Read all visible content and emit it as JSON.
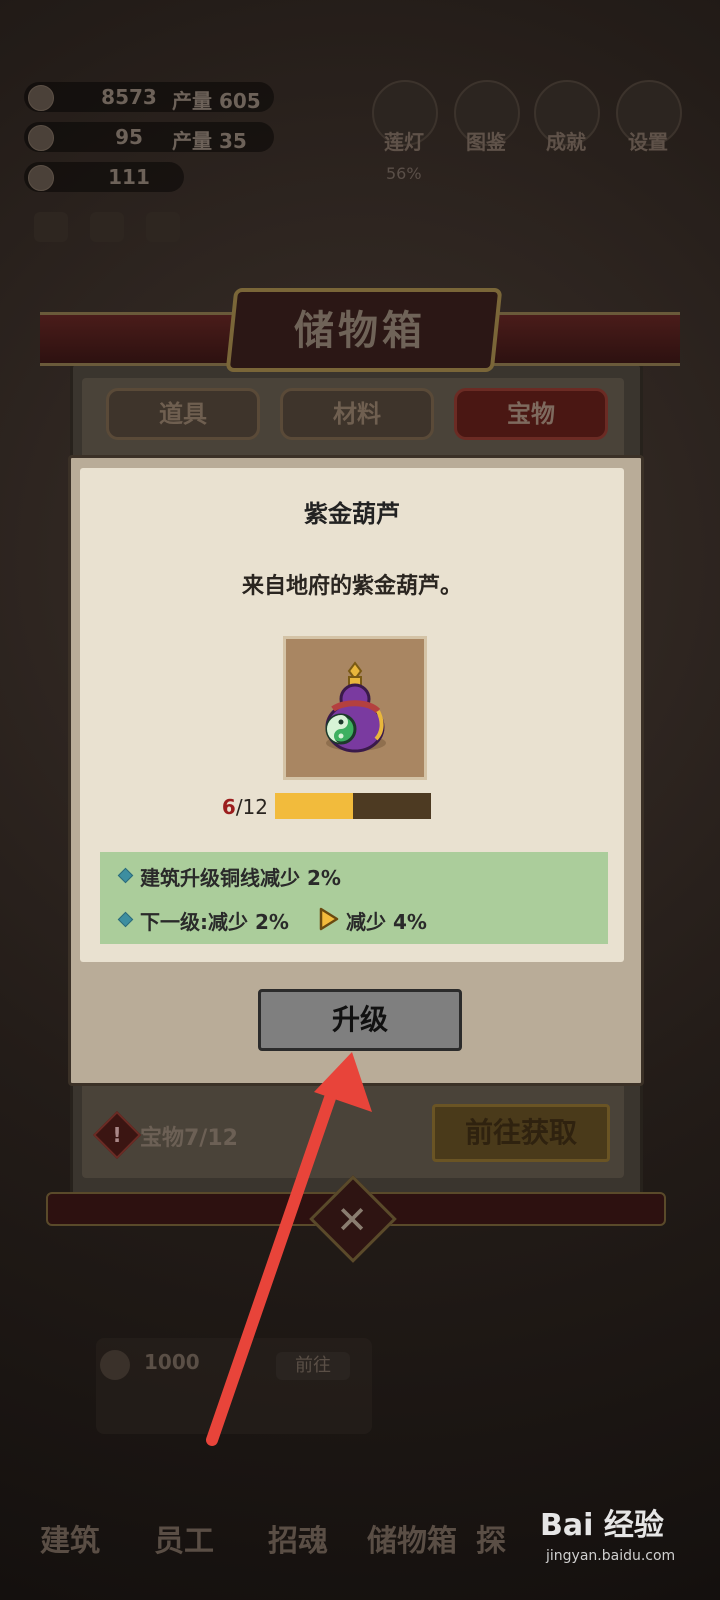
{
  "resources": [
    {
      "value": "8573",
      "production": "产量 605"
    },
    {
      "value": "95",
      "production": "产量 35"
    },
    {
      "value": "111",
      "production": ""
    }
  ],
  "top_buttons": [
    {
      "label": "莲灯",
      "icon": "lotus-icon",
      "sub": "56%"
    },
    {
      "label": "图鉴",
      "icon": "book-icon",
      "sub": ""
    },
    {
      "label": "成就",
      "icon": "banner-icon",
      "sub": ""
    },
    {
      "label": "设置",
      "icon": "gear-icon",
      "sub": ""
    }
  ],
  "storage": {
    "title": "储物箱",
    "tabs": [
      "道具",
      "材料",
      "宝物"
    ],
    "active_tab": "宝物",
    "treasure_count": "宝物7/12",
    "goto_button": "前往获取"
  },
  "dialog": {
    "item_name": "紫金葫芦",
    "item_desc": "来自地府的紫金葫芦。",
    "item_icon": "purple-gold-gourd-icon",
    "progress": {
      "current": "6",
      "total": "/12",
      "fraction": 0.5
    },
    "effects": {
      "line1": "建筑升级铜线减少 2%",
      "line2_label": "下一级:减少 2%",
      "line2_next": "减少 4%"
    },
    "upgrade_button": "升级"
  },
  "background_task": {
    "cost": "1000",
    "button": "前往"
  },
  "bottom_nav": [
    "建筑",
    "员工",
    "招魂",
    "储物箱",
    "探"
  ],
  "watermark": {
    "brand": "Bai 经验",
    "url": "jingyan.baidu.com"
  },
  "colors": {
    "accent_red": "#9b1d1d",
    "progress_fill": "#f2bb3c",
    "effect_bg": "#abcd9b",
    "annotation_arrow": "#e8443a"
  }
}
